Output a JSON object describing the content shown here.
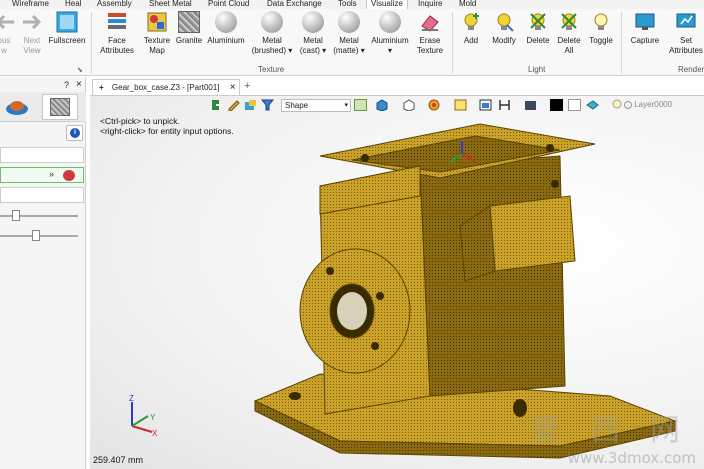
{
  "menubar": {
    "items": [
      "Wireframe",
      "Heal",
      "Assembly",
      "Sheet Metal",
      "Point Cloud",
      "Data Exchange",
      "Tools",
      "Visualize",
      "Inquire",
      "Mold"
    ],
    "active_index": 7
  },
  "ribbon": {
    "view_group": {
      "prev_view": "ous\nw",
      "next_view": "Next\nView",
      "fullscreen": "Fullscreen"
    },
    "texture_group": {
      "label": "Texture",
      "buttons": [
        {
          "label": "Face\nAttributes"
        },
        {
          "label": "Texture\nMap"
        },
        {
          "label": "Granite"
        },
        {
          "label": "Aluminium"
        },
        {
          "label": "Metal\n(brushed) ▾"
        },
        {
          "label": "Metal\n(cast) ▾"
        },
        {
          "label": "Metal\n(matte) ▾"
        },
        {
          "label": "Aluminium\n▾"
        },
        {
          "label": "Erase\nTexture"
        }
      ]
    },
    "light_group": {
      "label": "Light",
      "buttons": [
        {
          "label": "Add"
        },
        {
          "label": "Modify"
        },
        {
          "label": "Delete"
        },
        {
          "label": "Delete\nAll"
        },
        {
          "label": "Toggle"
        }
      ]
    },
    "render_group": {
      "label": "Render",
      "buttons": [
        {
          "label": "Capture"
        },
        {
          "label": "Set\nAttributes"
        }
      ]
    }
  },
  "document": {
    "tab_title": "Gear_box_case.Z3 - [Part001]",
    "tab_close": "×",
    "add_tab": "+",
    "pin": "+"
  },
  "viewport_toolbar": {
    "shape_filter": "Shape",
    "layer": "Layer0000",
    "accent": "#3a7bd5"
  },
  "viewport": {
    "hint_line1": "<Ctrl-pick> to unpick.",
    "hint_line2": "<right-click> for entity input options.",
    "scale_readout": "259.407 mm",
    "model_color": "#c9a227",
    "model_edge_color": "#5a4400"
  },
  "axes": {
    "x": "X",
    "y": "Y",
    "z": "Z"
  },
  "left_panel": {
    "panel_buttons": [
      "?",
      "×"
    ],
    "info_icon": "i"
  },
  "watermark": {
    "glyphs": "夏 西 网",
    "url": "www.3dmox.com"
  }
}
